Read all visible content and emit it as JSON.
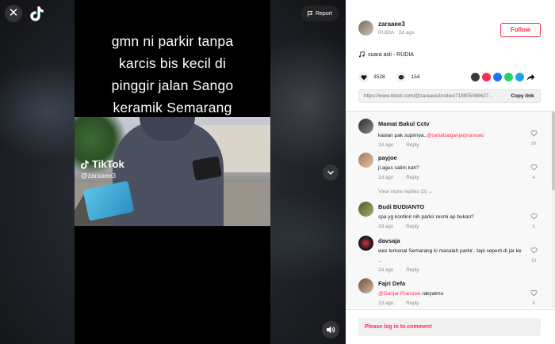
{
  "video": {
    "caption_lines": [
      "gmn ni parkir tanpa",
      "karcis  bis kecil di",
      "pinggir jalan Sango",
      "keramik Semarang"
    ],
    "watermark_brand": "TikTok",
    "watermark_user": "@zaraaee3",
    "report_label": "Report"
  },
  "author": {
    "username": "zaraaee3",
    "subline": "RUDIA · 2d ago",
    "follow_label": "Follow"
  },
  "music": {
    "title": "suara asli - RUDIA"
  },
  "stats": {
    "likes": "3528",
    "comments": "154"
  },
  "link": {
    "url": "https://www.tiktok.com/@zaraaee3/video/718905088627...",
    "copy_label": "Copy link"
  },
  "comments": [
    {
      "user": "Mamat Bakul Cctv",
      "text_prefix": "kasian pak supirnya..",
      "mention": "@sahabatganjarpranowo",
      "text_suffix": "",
      "time": "2d ago",
      "reply": "Reply",
      "likes": "20"
    },
    {
      "user": "payjoe",
      "text_prefix": "jl.agus salim kah?",
      "mention": "",
      "text_suffix": "",
      "time": "2d ago",
      "reply": "Reply",
      "likes": "4"
    },
    {
      "user": "Budi BUDIANTO",
      "text_prefix": "spa yg kordinir nih parkir resmi ap bukan?",
      "mention": "",
      "text_suffix": "",
      "time": "2d ago",
      "reply": "Reply",
      "likes": "5"
    },
    {
      "user": "davsaja",
      "text_prefix": "wes terkenal Semarang ki masalah parkir.. tapi seperti di jar ke ..",
      "mention": "",
      "text_suffix": "",
      "time": "2d ago",
      "reply": "Reply",
      "likes": "10"
    },
    {
      "user": "Fajri Defa",
      "text_prefix": "",
      "mention": "@Ganjar Pranowo",
      "text_suffix": " rakyatmu",
      "time": "2d ago",
      "reply": "Reply",
      "likes": "9"
    }
  ],
  "more_replies_label": "View more replies (3)",
  "login_prompt": "Please log in to comment",
  "colors": {
    "accent": "#fe2c55",
    "panel_bg": "#ffffff",
    "comments_bg": "#f8f8f8"
  }
}
